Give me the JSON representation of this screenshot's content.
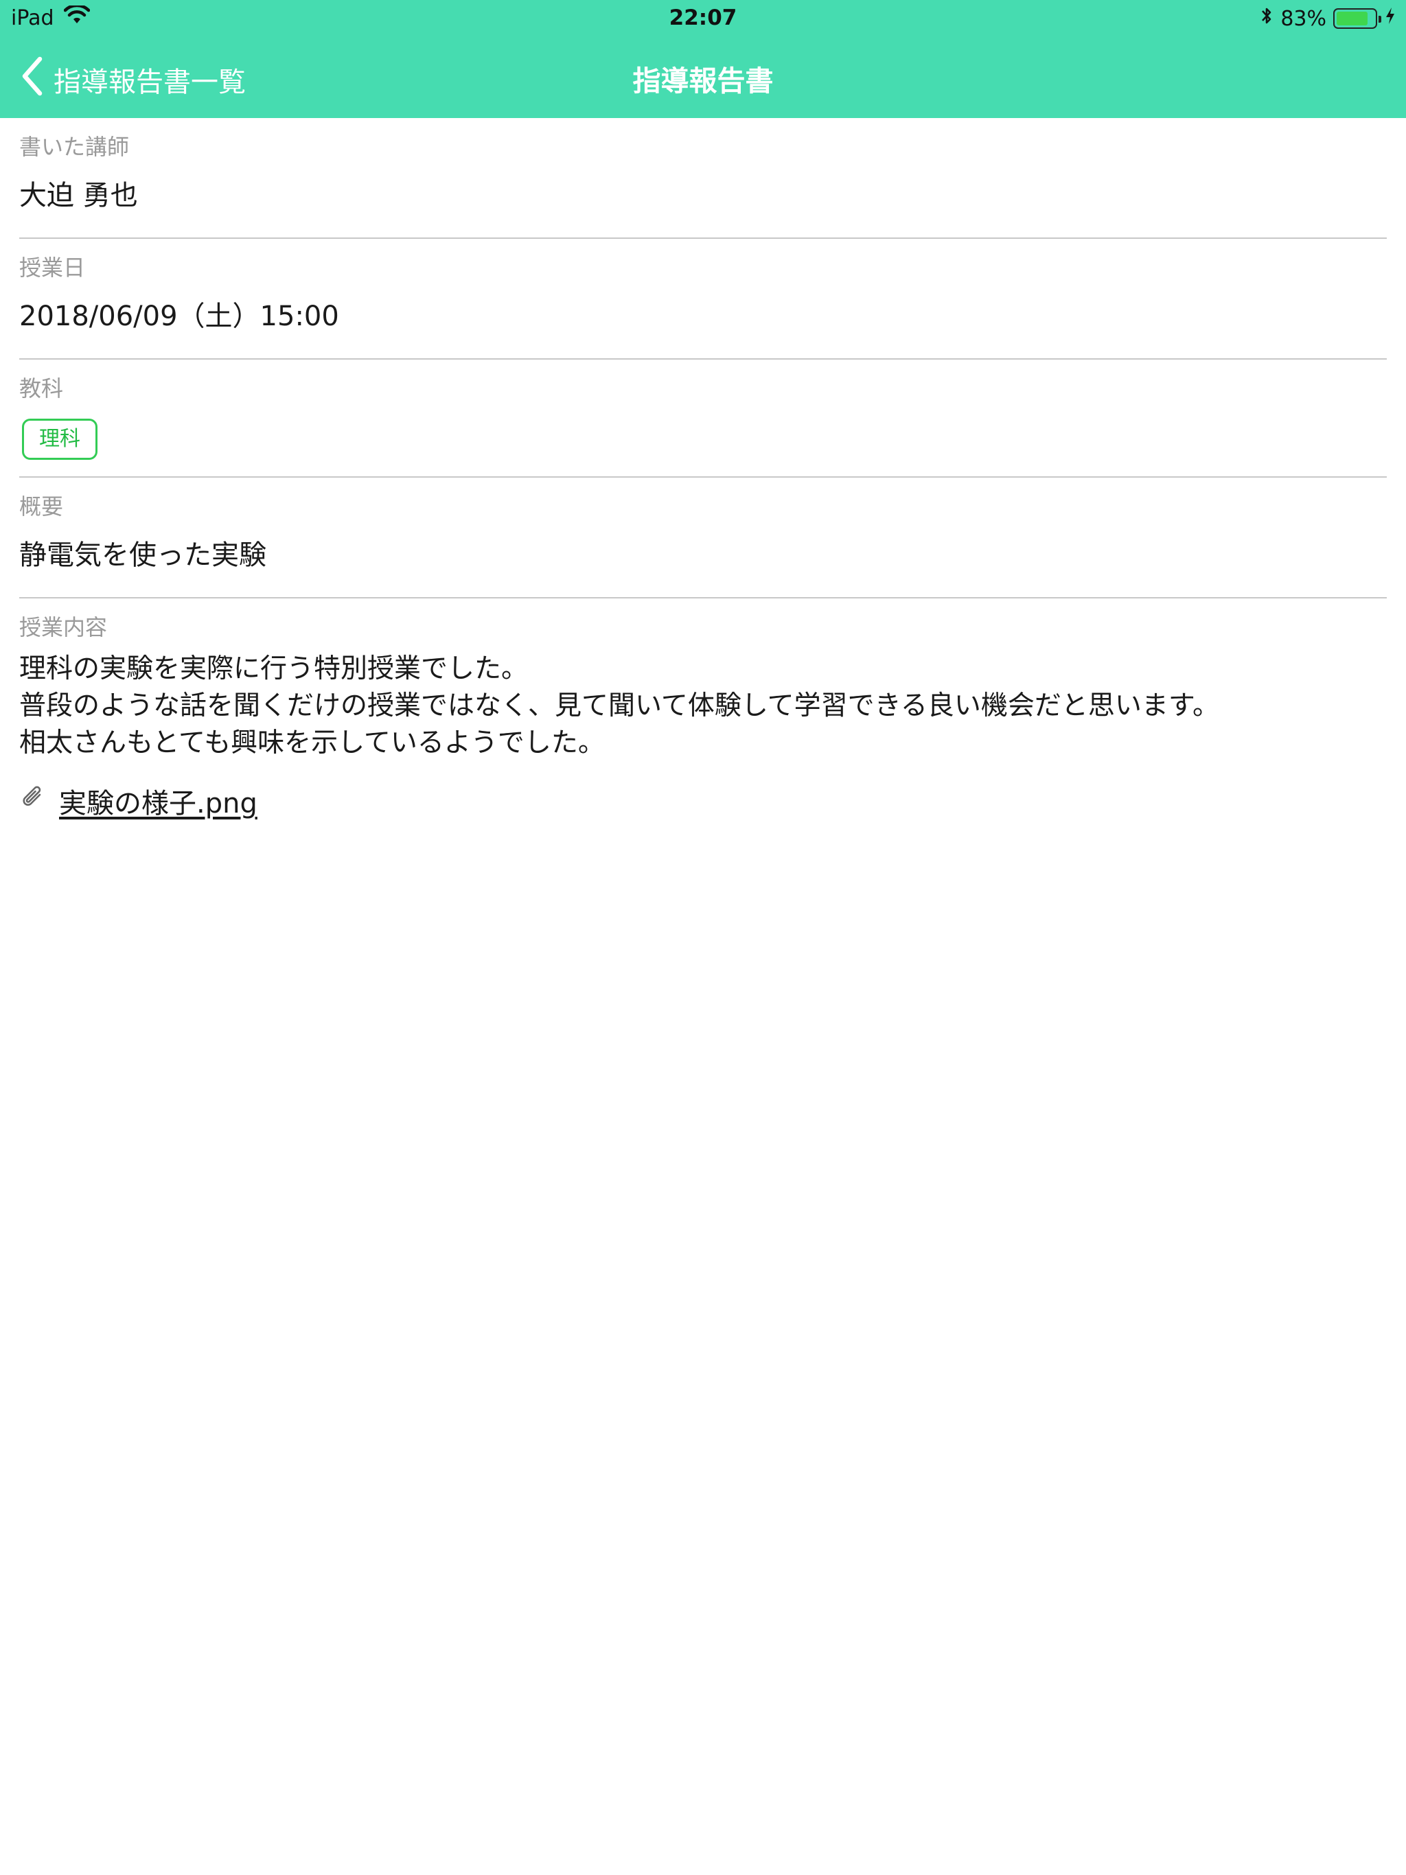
{
  "status_bar": {
    "device": "iPad",
    "time": "22:07",
    "battery_percent": "83%",
    "battery_level": 0.83
  },
  "nav": {
    "back_label": "指導報告書一覧",
    "title": "指導報告書"
  },
  "fields": {
    "teacher": {
      "label": "書いた講師",
      "value": "大迫 勇也"
    },
    "class_date": {
      "label": "授業日",
      "value": "2018/06/09（土）15:00"
    },
    "subject": {
      "label": "教科",
      "tag": "理科"
    },
    "summary": {
      "label": "概要",
      "value": "静電気を使った実験"
    },
    "content": {
      "label": "授業内容",
      "lines": [
        "理科の実験を実際に行う特別授業でした。",
        "普段のような話を聞くだけの授業ではなく、見て聞いて体験して学習できる良い機会だと思います。",
        "相太さんもとても興味を示しているようでした。"
      ]
    }
  },
  "attachment": {
    "filename": "実験の様子.png"
  },
  "colors": {
    "header_bg": "#46dcb0",
    "tag_green": "#33cc55",
    "label_gray": "#9a9a9a"
  }
}
